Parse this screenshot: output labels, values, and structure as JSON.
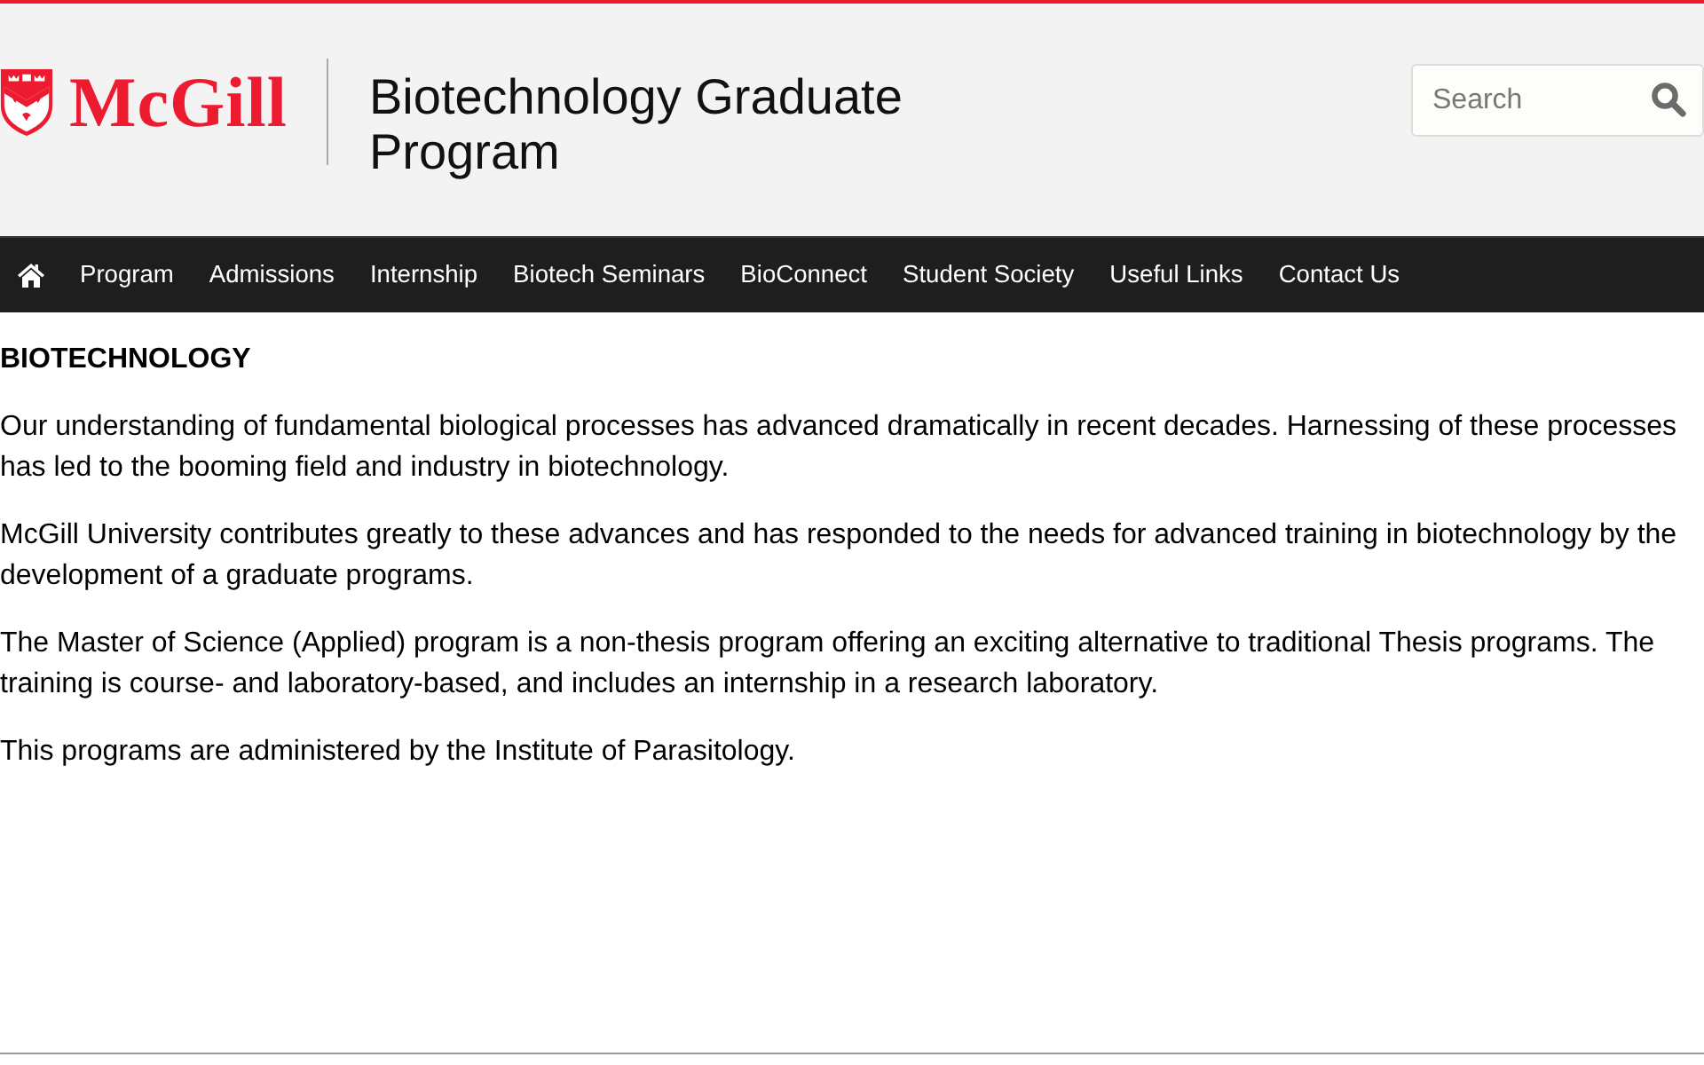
{
  "header": {
    "logo": {
      "wordmark": "McGill"
    },
    "title": "Biotechnology Graduate Program",
    "search": {
      "placeholder": "Search"
    }
  },
  "nav": {
    "items": [
      {
        "kind": "home"
      },
      {
        "kind": "link",
        "label": "Program"
      },
      {
        "kind": "link",
        "label": "Admissions"
      },
      {
        "kind": "link",
        "label": "Internship"
      },
      {
        "kind": "link",
        "label": "Biotech Seminars"
      },
      {
        "kind": "link",
        "label": "BioConnect"
      },
      {
        "kind": "link",
        "label": "Student Society"
      },
      {
        "kind": "link",
        "label": "Useful Links"
      },
      {
        "kind": "link",
        "label": "Contact Us"
      }
    ]
  },
  "content": {
    "heading": "BIOTECHNOLOGY",
    "paragraphs": [
      "Our understanding of fundamental biological processes has advanced dramatically in recent decades. Harnessing of these processes has led to the booming field and industry in biotechnology.",
      "McGill University contributes greatly to these advances and has responded to the needs for advanced training in biotechnology by the development of a graduate programs.",
      "The Master of Science (Applied) program is a non-thesis program offering an exciting alternative to traditional Thesis programs. The training is course- and laboratory-based, and includes an internship in a research laboratory.",
      "This programs are administered by the Institute of Parasitology."
    ]
  }
}
